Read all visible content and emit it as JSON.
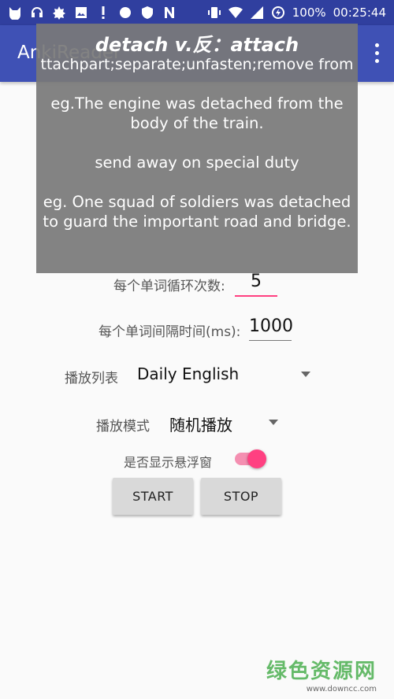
{
  "status_bar": {
    "battery": "100%",
    "time": "00:25:44",
    "left_icons": [
      "cat-icon",
      "headphones-icon",
      "leaf-icon",
      "image-icon",
      "alert-icon",
      "cloud-icon",
      "shield-icon",
      "n-icon"
    ],
    "right_icons": [
      "vibrate-icon",
      "wifi-icon",
      "signal-icon",
      "battery-saver-icon"
    ]
  },
  "app_bar": {
    "title": "AnkiReader",
    "menu_icon": "overflow-menu-icon",
    "color": "#3f51b5"
  },
  "popup": {
    "title": "detach v.反：attach",
    "subtitle": "ttachpart;separate;unfasten;remove from",
    "paragraphs": [
      "eg.The engine was detached from the body of the train.",
      "send away on special duty",
      "eg. One squad of soldiers was detached to guard the important road and bridge."
    ]
  },
  "form": {
    "loop_count_label": "每个单词循环次数:",
    "loop_count_value": "5",
    "interval_label": "每个单词间隔时间(ms):",
    "interval_value": "1000",
    "playlist_label": "播放列表",
    "playlist_value": "Daily English",
    "mode_label": "播放模式",
    "mode_value": "随机播放",
    "float_window_label": "是否显示悬浮窗",
    "float_window_on": true,
    "accent_color": "#ff4081"
  },
  "buttons": {
    "start": "START",
    "stop": "STOP"
  },
  "watermark": {
    "text": "绿色资源网",
    "url": "www.downcc.com"
  }
}
